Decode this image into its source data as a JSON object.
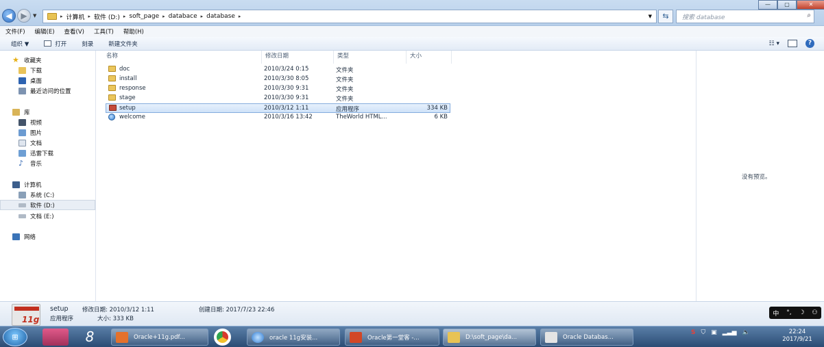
{
  "address": {
    "crumbs": [
      "计算机",
      "软件 (D:)",
      "soft_page",
      "databace",
      "database"
    ],
    "placeholder": "搜索 database"
  },
  "menu": [
    "文件(F)",
    "编辑(E)",
    "查看(V)",
    "工具(T)",
    "帮助(H)"
  ],
  "toolbar": {
    "organize": "组织 ▼",
    "open": "打开",
    "burn": "刻录",
    "new_folder": "新建文件夹"
  },
  "nav": {
    "favorites": {
      "label": "收藏夹",
      "items": [
        "下载",
        "桌面",
        "最近访问的位置"
      ]
    },
    "libraries": {
      "label": "库",
      "items": [
        "视频",
        "图片",
        "文档",
        "迅雷下载",
        "音乐"
      ]
    },
    "computer": {
      "label": "计算机",
      "items": [
        "系统 (C:)",
        "软件 (D:)",
        "文档 (E:)"
      ]
    },
    "network": "网络"
  },
  "columns": {
    "name": "名称",
    "date": "修改日期",
    "type": "类型",
    "size": "大小"
  },
  "files": [
    {
      "name": "doc",
      "date": "2010/3/24 0:15",
      "type": "文件夹",
      "size": "",
      "icon": "folder-icon"
    },
    {
      "name": "install",
      "date": "2010/3/30 8:05",
      "type": "文件夹",
      "size": "",
      "icon": "folder-icon"
    },
    {
      "name": "response",
      "date": "2010/3/30 9:31",
      "type": "文件夹",
      "size": "",
      "icon": "folder-icon"
    },
    {
      "name": "stage",
      "date": "2010/3/30 9:31",
      "type": "文件夹",
      "size": "",
      "icon": "folder-icon"
    },
    {
      "name": "setup",
      "date": "2010/3/12 1:11",
      "type": "应用程序",
      "size": "334 KB",
      "icon": "oracle-app-icon"
    },
    {
      "name": "welcome",
      "date": "2010/3/16 13:42",
      "type": "TheWorld HTML...",
      "size": "6 KB",
      "icon": "html-icon"
    }
  ],
  "preview": "没有预览。",
  "details": {
    "name": "setup",
    "type": "应用程序",
    "modified": "修改日期: 2010/3/12 1:11",
    "size": "大小: 333 KB",
    "created": "创建日期: 2017/7/23 22:46",
    "logo_text": "11g"
  },
  "ime": [
    "中",
    "°,",
    "☽",
    "⚇"
  ],
  "taskbar": {
    "windows": [
      "Oracle+11g.pdf...",
      "oracle 11g安装...",
      "Oracle第一堂客 -...",
      "D:\\soft_page\\da...",
      "Oracle Databas..."
    ]
  },
  "clock": {
    "time": "22:24",
    "date": "2017/9/21"
  }
}
